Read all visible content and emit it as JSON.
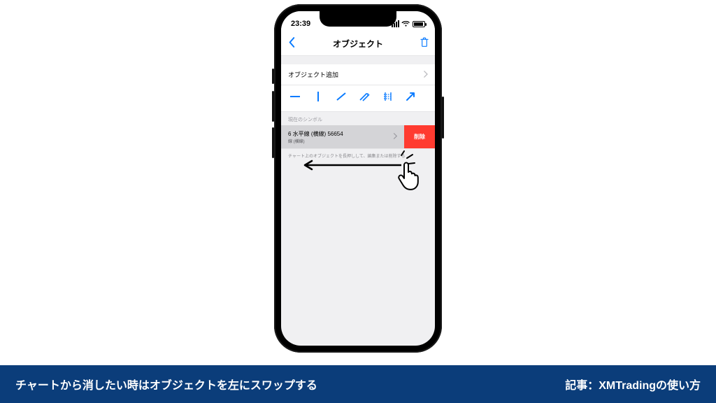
{
  "statusbar": {
    "time": "23:39"
  },
  "nav": {
    "title": "オブジェクト"
  },
  "add_row": {
    "label": "オブジェクト追加"
  },
  "section": {
    "label": "現在のシンボル"
  },
  "object": {
    "title": "6 水平線 (横線) 56654",
    "subtitle": "線 (横線)",
    "delete_label": "削除"
  },
  "hint": "チャート上のオブジェクトを長押しして、編集または削除する",
  "banner": {
    "left": "チャートから消したい時はオブジェクトを左にスワップする",
    "right": "記事：XMTradingの使い方"
  }
}
